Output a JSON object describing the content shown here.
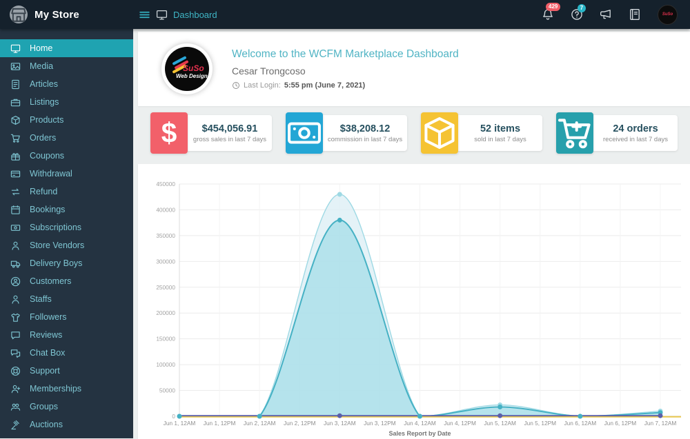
{
  "topbar": {
    "store_name": "My Store",
    "breadcrumb": "Dashboard",
    "bell_badge": "429",
    "help_badge": "7"
  },
  "sidebar": {
    "items": [
      {
        "label": "Home",
        "icon": "monitor-icon",
        "active": true
      },
      {
        "label": "Media",
        "icon": "image-icon",
        "active": false
      },
      {
        "label": "Articles",
        "icon": "article-icon",
        "active": false
      },
      {
        "label": "Listings",
        "icon": "briefcase-icon",
        "active": false
      },
      {
        "label": "Products",
        "icon": "box-icon",
        "active": false
      },
      {
        "label": "Orders",
        "icon": "cart-icon",
        "active": false
      },
      {
        "label": "Coupons",
        "icon": "gift-icon",
        "active": false
      },
      {
        "label": "Withdrawal",
        "icon": "card-icon",
        "active": false
      },
      {
        "label": "Refund",
        "icon": "refund-icon",
        "active": false
      },
      {
        "label": "Bookings",
        "icon": "calendar-icon",
        "active": false
      },
      {
        "label": "Subscriptions",
        "icon": "money-icon",
        "active": false
      },
      {
        "label": "Store Vendors",
        "icon": "person-icon",
        "active": false
      },
      {
        "label": "Delivery Boys",
        "icon": "truck-icon",
        "active": false
      },
      {
        "label": "Customers",
        "icon": "person-circle-icon",
        "active": false
      },
      {
        "label": "Staffs",
        "icon": "person-icon",
        "active": false
      },
      {
        "label": "Followers",
        "icon": "shirt-icon",
        "active": false
      },
      {
        "label": "Reviews",
        "icon": "comment-icon",
        "active": false
      },
      {
        "label": "Chat Box",
        "icon": "chat-icon",
        "active": false
      },
      {
        "label": "Support",
        "icon": "support-icon",
        "active": false
      },
      {
        "label": "Memberships",
        "icon": "person-plus-icon",
        "active": false
      },
      {
        "label": "Groups",
        "icon": "people-icon",
        "active": false
      },
      {
        "label": "Auctions",
        "icon": "auction-icon",
        "active": false
      }
    ]
  },
  "welcome": {
    "title": "Welcome to the WCFM Marketplace Dashboard",
    "user_name": "Cesar Trongcoso",
    "last_login_label": "Last Login:",
    "last_login_value": "5:55 pm (June 7, 2021)",
    "logo_text_primary": "SuSo",
    "logo_text_secondary": "Web Design"
  },
  "stats": [
    {
      "value": "$454,056.91",
      "label": "gross sales in last 7 days",
      "icon": "dollar-icon",
      "color": "#f2606a"
    },
    {
      "value": "$38,208.12",
      "label": "commission in last 7 days",
      "icon": "money-bill-icon",
      "color": "#23a6d5"
    },
    {
      "value": "52 items",
      "label": "sold in last 7 days",
      "icon": "box-icon",
      "color": "#f5c333"
    },
    {
      "value": "24 orders",
      "label": "received in last 7 days",
      "icon": "cart-plus-icon",
      "color": "#27a0ac"
    }
  ],
  "chart_data": {
    "type": "area",
    "title": "Sales Report by Date",
    "x_labels": [
      "Jun 1, 12AM",
      "Jun 1, 12PM",
      "Jun 2, 12AM",
      "Jun 2, 12PM",
      "Jun 3, 12AM",
      "Jun 3, 12PM",
      "Jun 4, 12AM",
      "Jun 4, 12PM",
      "Jun 5, 12AM",
      "Jun 5, 12PM",
      "Jun 6, 12AM",
      "Jun 6, 12PM",
      "Jun 7, 12AM"
    ],
    "ylim": [
      0,
      450000
    ],
    "y_tick_step": 50000,
    "grid": true,
    "legend": "none",
    "series": [
      {
        "name": "gross-sales-outer-area",
        "type": "area",
        "color": "#9ed9e4",
        "fill": "#ddeff5",
        "fill_opacity": 0.8,
        "line_width": 1.4,
        "x_label_indices": [
          0,
          2,
          4,
          6,
          8,
          10,
          12
        ],
        "values": [
          0,
          0,
          430000,
          0,
          22000,
          0,
          10000
        ],
        "markers": "all"
      },
      {
        "name": "net-earnings-inner-area",
        "type": "area",
        "color": "#45b1c4",
        "fill": "#a9dee9",
        "fill_opacity": 0.8,
        "line_width": 2,
        "x_label_indices": [
          0,
          2,
          4,
          6,
          8,
          10,
          12
        ],
        "values": [
          0,
          0,
          380000,
          0,
          18000,
          0,
          7000
        ],
        "markers": "all"
      },
      {
        "name": "yellow-flat-line",
        "type": "line",
        "color": "#eac84f",
        "line_width": 2,
        "x_label_indices": [
          0,
          2,
          4,
          6,
          8,
          10,
          12
        ],
        "values": [
          0,
          0,
          0,
          0,
          0,
          0,
          0
        ],
        "extends_full_width": true
      },
      {
        "name": "indigo-flat-line",
        "type": "line",
        "color": "#5c5fa9",
        "line_width": 1.8,
        "x_label_indices": [
          0,
          2,
          4,
          6,
          8,
          10,
          12
        ],
        "values": [
          0,
          0,
          0,
          0,
          0,
          0,
          0
        ],
        "marker_indices": [
          2,
          4,
          6
        ]
      }
    ]
  }
}
